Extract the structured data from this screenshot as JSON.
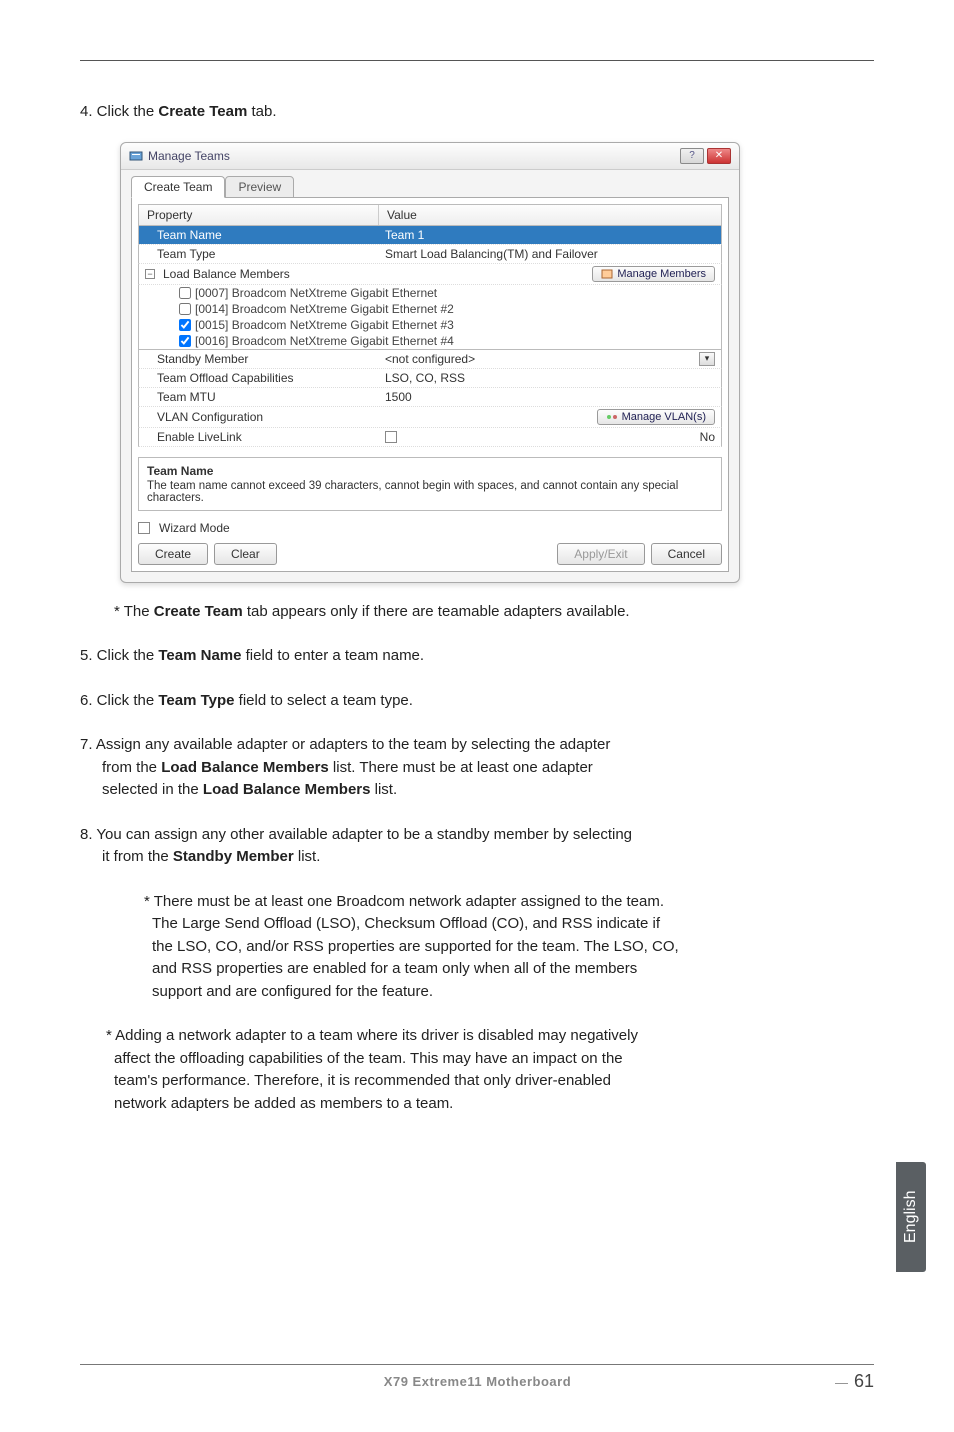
{
  "step4": {
    "prefix": "4. Click the ",
    "bold": "Create Team",
    "suffix": " tab."
  },
  "dialog": {
    "title": "Manage Teams",
    "tab_create": "Create Team",
    "tab_preview": "Preview",
    "header_property": "Property",
    "header_value": "Value",
    "rows": {
      "team_name_label": "Team Name",
      "team_name_value": "Team 1",
      "team_type_label": "Team Type",
      "team_type_value": "Smart Load Balancing(TM) and Failover",
      "load_balance_label": "Load Balance Members",
      "manage_members_btn": "Manage Members",
      "adapters": [
        "[0007] Broadcom NetXtreme Gigabit Ethernet",
        "[0014] Broadcom NetXtreme Gigabit Ethernet #2",
        "[0015] Broadcom NetXtreme Gigabit Ethernet #3",
        "[0016] Broadcom NetXtreme Gigabit Ethernet #4"
      ],
      "standby_label": "Standby Member",
      "standby_value": "<not configured>",
      "offload_label": "Team Offload Capabilities",
      "offload_value": "LSO, CO, RSS",
      "mtu_label": "Team MTU",
      "mtu_value": "1500",
      "vlan_label": "VLAN Configuration",
      "manage_vlan_btn": "Manage VLAN(s)",
      "livelink_label": "Enable LiveLink",
      "livelink_value": "No"
    },
    "desc_title": "Team Name",
    "desc_text": "The team name cannot exceed 39 characters, cannot begin with spaces, and cannot contain any special characters.",
    "wizard_label": "Wizard Mode",
    "btn_create": "Create",
    "btn_clear": "Clear",
    "btn_apply": "Apply/Exit",
    "btn_cancel": "Cancel"
  },
  "note_after_dialog": {
    "prefix": "* The ",
    "bold": "Create Team",
    "suffix": " tab appears only if there are teamable adapters available."
  },
  "step5": {
    "prefix": "5. Click the ",
    "bold": "Team Name",
    "suffix": " field to enter a team name."
  },
  "step6": {
    "prefix": "6. Click the ",
    "bold": "Team Type",
    "suffix": " field to select a team type."
  },
  "step7": {
    "line1_prefix": "7. Assign any available adapter or adapters to the team by selecting the adapter",
    "line2_prefix": "from the ",
    "line2_bold": "Load Balance Members",
    "line2_suffix": " list. There must be at least one adapter",
    "line3_prefix": "selected in the ",
    "line3_bold": "Load Balance Members",
    "line3_suffix": " list."
  },
  "step8": {
    "line1": "8. You can assign any other available adapter to be a standby member by selecting",
    "line2_prefix": "it from the ",
    "line2_bold": "Standby Member",
    "line2_suffix": " list."
  },
  "note8a": {
    "l1": "* There must be at least one Broadcom network adapter assigned to the team.",
    "l2": "The Large Send Offload (LSO), Checksum Offload (CO), and RSS indicate if",
    "l3": "the LSO, CO, and/or RSS properties are supported for the team. The LSO, CO,",
    "l4": "and RSS properties are enabled for a team only when all of the members",
    "l5": "support and are configured for the feature."
  },
  "note8b": {
    "l1": "* Adding a network adapter to a team where its driver is disabled may negatively",
    "l2": "affect the offloading capabilities of the team. This may have an impact on the",
    "l3": "team's performance. Therefore, it is recommended that only driver-enabled",
    "l4": "network adapters be added as members to a team."
  },
  "side_tab": "English",
  "footer_title": "X79  Extreme11  Motherboard",
  "page_number": "61"
}
